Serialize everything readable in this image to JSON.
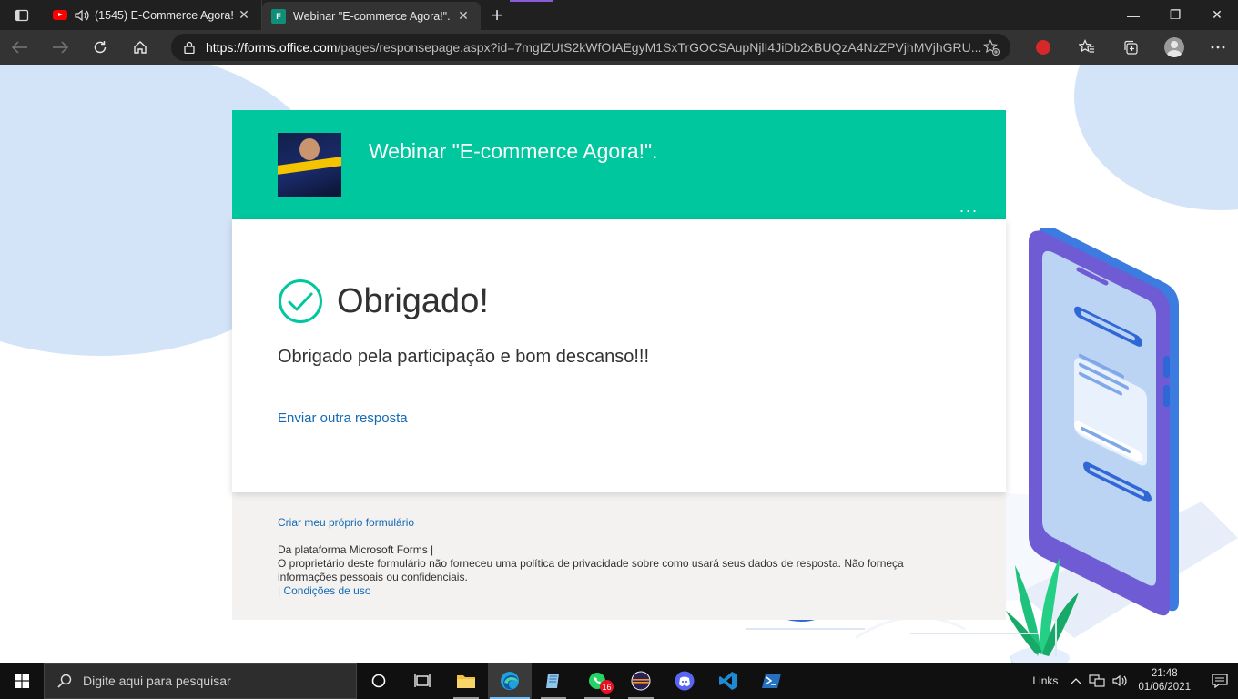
{
  "browser": {
    "tabs": [
      {
        "title": "(1545) E-Commerce Agora!",
        "icon": "youtube-icon",
        "audio": true,
        "active": false
      },
      {
        "title": "Webinar \"E-commerce Agora!\".",
        "icon": "forms-icon",
        "active": true
      }
    ],
    "address": {
      "protocol": "https://",
      "host": "forms.office.com",
      "path": "/pages/responsepage.aspx?id=7mgIZUtS2kWfOIAEgyM1SxTrGOCSAupNjlI4JiDb2xBUQzA4NzZPVjhMVjhGRU..."
    }
  },
  "form": {
    "header_title": "Webinar \"E-commerce Agora!\".",
    "header_more": "...",
    "thanks_title": "Obrigado!",
    "thanks_message": "Obrigado pela participação e bom descanso!!!",
    "submit_another": "Enviar outra resposta",
    "accent_color": "#00c79e"
  },
  "footer": {
    "own_form_link": "Criar meu próprio formulário",
    "platform_line": "Da plataforma Microsoft Forms |",
    "privacy_line": "O proprietário deste formulário não forneceu uma política de privacidade sobre como usará seus dados de resposta. Não forneça informações pessoais ou confidenciais.",
    "terms_prefix": "| ",
    "terms_link": "Condições de uso"
  },
  "taskbar": {
    "search_placeholder": "Digite aqui para pesquisar",
    "whatsapp_badge": "16",
    "links_label": "Links",
    "time": "21:48",
    "date": "01/06/2021"
  }
}
